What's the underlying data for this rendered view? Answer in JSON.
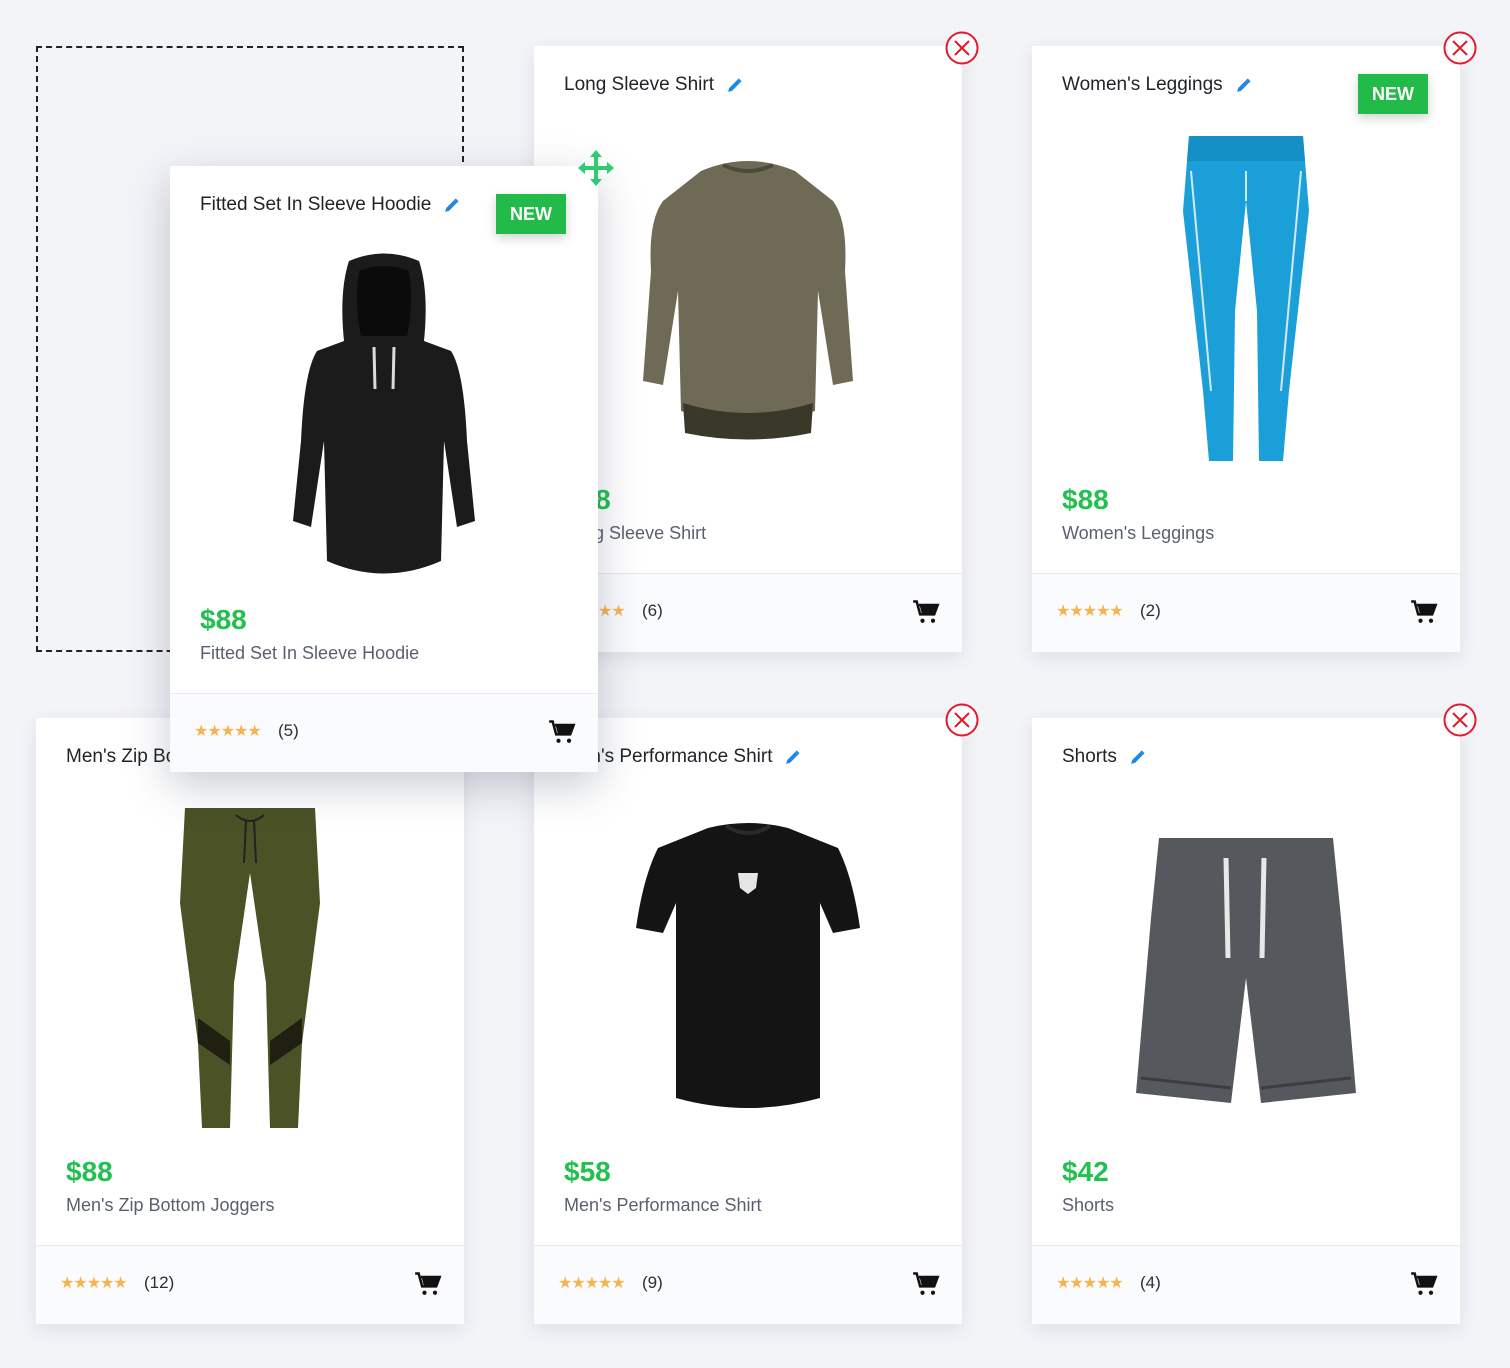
{
  "cards": [
    {
      "title": "Long Sleeve Shirt",
      "price": "$88",
      "name": "Long Sleeve Shirt",
      "count": "(6)",
      "garment": "long-sleeve-shirt",
      "garment_color": "#6f6a55"
    },
    {
      "title": "Women's Leggings",
      "price": "$88",
      "name": "Women's Leggings",
      "count": "(2)",
      "badge": "NEW",
      "garment": "leggings",
      "garment_color": "#1a9fd9"
    },
    {
      "title": "Men's Zip Bottom Joggers",
      "price": "$88",
      "name": "Men's Zip Bottom Joggers",
      "count": "(12)",
      "garment": "joggers",
      "garment_color": "#4a5226"
    },
    {
      "title": "Men's Performance Shirt",
      "price": "$58",
      "name": "Men's Performance Shirt",
      "count": "(9)",
      "garment": "tshirt",
      "garment_color": "#141414"
    },
    {
      "title": "Shorts",
      "price": "$42",
      "name": "Shorts",
      "count": "(4)",
      "garment": "shorts",
      "garment_color": "#55585c"
    }
  ],
  "dragging_card": {
    "title": "Fitted Set In Sleeve Hoodie",
    "price": "$88",
    "name": "Fitted Set In Sleeve Hoodie",
    "count": "(5)",
    "badge": "NEW",
    "garment": "hoodie",
    "garment_color": "#1b1b1b"
  },
  "stars": "★★★★★",
  "colors": {
    "price": "#21c04f",
    "badge": "#22bb49",
    "close": "#e4192b",
    "edit": "#1e88e5",
    "move": "#2ecc71",
    "star": "#f5b451"
  },
  "icons": [
    "edit-icon",
    "close-icon",
    "cart-icon",
    "move-icon",
    "star-icon"
  ]
}
